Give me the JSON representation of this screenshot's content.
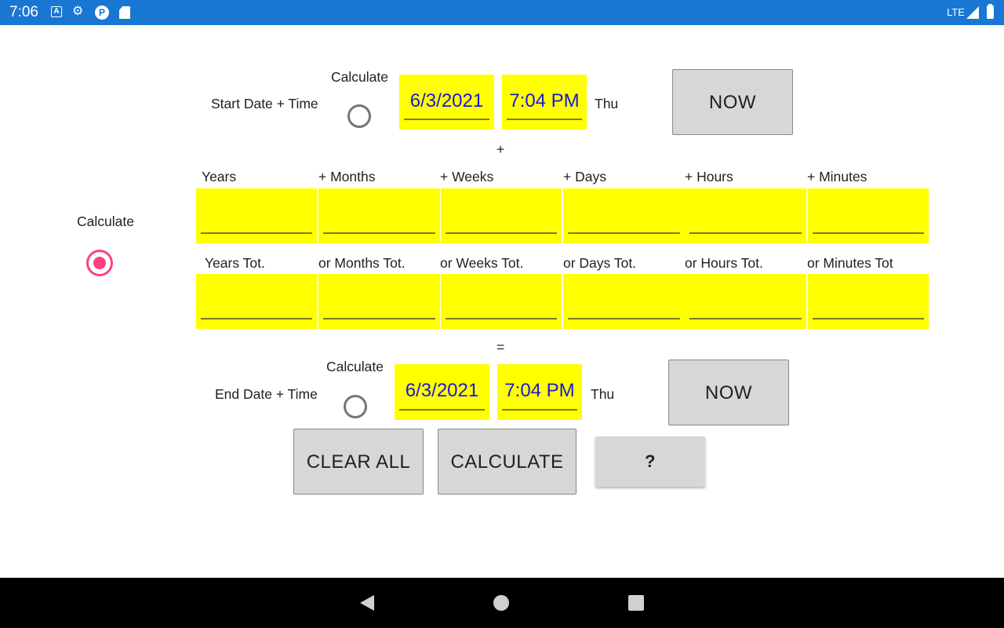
{
  "status_bar": {
    "time": "7:06",
    "network": "LTE"
  },
  "start": {
    "label": "Start Date + Time",
    "calculate_label": "Calculate",
    "date": "6/3/2021",
    "time": "7:04 PM",
    "weekday": "Thu",
    "now_label": "NOW"
  },
  "plus_sign": "+",
  "side": {
    "calculate_label": "Calculate"
  },
  "increments": {
    "headers": [
      "Years",
      "+ Months",
      "+ Weeks",
      "+ Days",
      "+ Hours",
      "+ Minutes"
    ],
    "values": [
      "",
      "",
      "",
      "",
      "",
      ""
    ]
  },
  "totals": {
    "headers": [
      "Years Tot.",
      "or Months Tot.",
      "or Weeks Tot.",
      "or Days Tot.",
      "or Hours Tot.",
      "or Minutes Tot"
    ],
    "values": [
      "",
      "",
      "",
      "",
      "",
      ""
    ]
  },
  "equals_sign": "=",
  "end": {
    "label": "End Date + Time",
    "calculate_label": "Calculate",
    "date": "6/3/2021",
    "time": "7:04 PM",
    "weekday": "Thu",
    "now_label": "NOW"
  },
  "actions": {
    "clear_all": "CLEAR ALL",
    "calculate": "CALCULATE",
    "help": "?"
  },
  "radios": {
    "start_checked": false,
    "duration_checked": true,
    "end_checked": false
  },
  "colors": {
    "status_bar": "#1976d2",
    "field_bg": "#ffff00",
    "value_text": "#1a1acd",
    "radio_accent": "#ff4081"
  },
  "icons": [
    "accessibility-icon",
    "settings-icon",
    "app-icon",
    "sd-card-icon",
    "signal-icon",
    "battery-icon",
    "back-icon",
    "home-icon",
    "recents-icon"
  ]
}
